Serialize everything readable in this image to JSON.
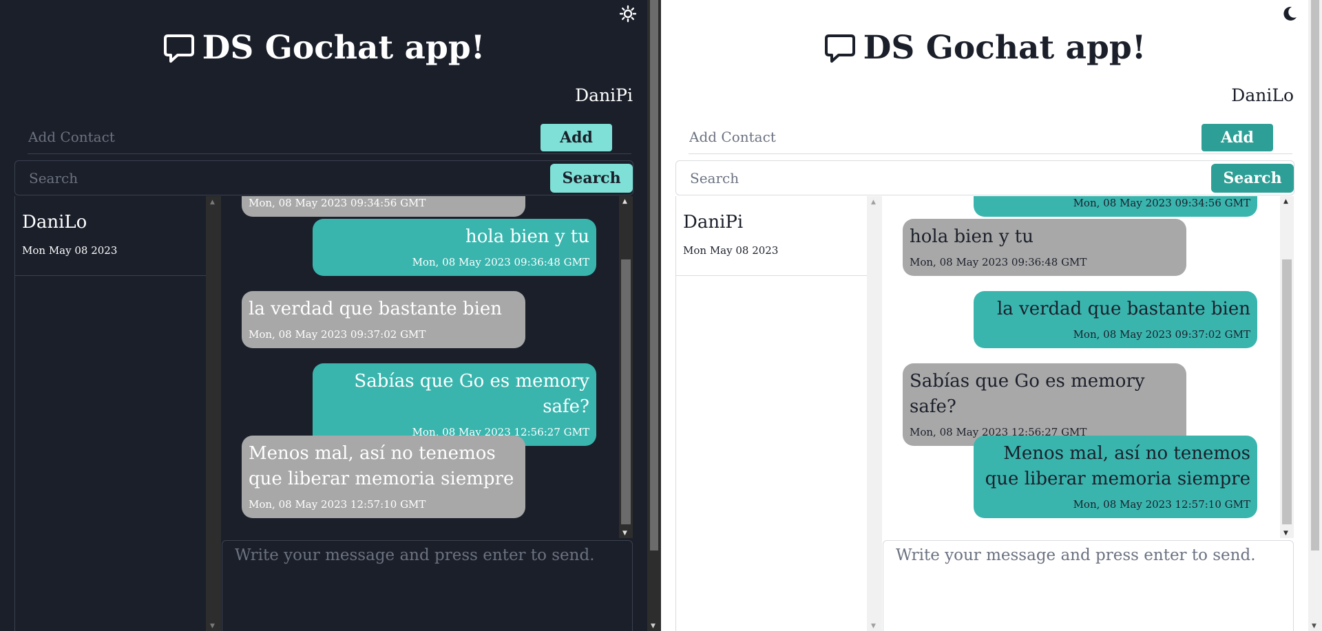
{
  "app": {
    "title": "DS Gochat app!"
  },
  "panes": [
    {
      "theme": "dark",
      "toggle_icon": "sun-icon",
      "username": "DaniPi",
      "add_contact_placeholder": "Add Contact",
      "add_label": "Add",
      "search_placeholder": "Search",
      "search_label": "Search",
      "contacts": [
        {
          "name": "DaniLo",
          "date": "Mon May 08 2023"
        }
      ],
      "messages": [
        {
          "side": "left",
          "text": "",
          "time": "Mon, 08 May 2023 09:34:56 GMT"
        },
        {
          "side": "right",
          "text": "hola bien y tu",
          "time": "Mon, 08 May 2023 09:36:48 GMT"
        },
        {
          "side": "left",
          "text": "la verdad que bastante bien",
          "time": "Mon, 08 May 2023 09:37:02 GMT"
        },
        {
          "side": "right",
          "text": "Sabías que Go es memory safe?",
          "time": "Mon, 08 May 2023 12:56:27 GMT"
        },
        {
          "side": "left",
          "text": "Menos mal, así no tenemos que liberar memoria siempre",
          "time": "Mon, 08 May 2023 12:57:10 GMT"
        }
      ],
      "compose_placeholder": "Write your message and press enter to send."
    },
    {
      "theme": "light",
      "toggle_icon": "moon-icon",
      "username": "DaniLo",
      "add_contact_placeholder": "Add Contact",
      "add_label": "Add",
      "search_placeholder": "Search",
      "search_label": "Search",
      "contacts": [
        {
          "name": "DaniPi",
          "date": "Mon May 08 2023"
        }
      ],
      "messages": [
        {
          "side": "right",
          "text": "",
          "time": "Mon, 08 May 2023 09:34:56 GMT"
        },
        {
          "side": "left",
          "text": "hola bien y tu",
          "time": "Mon, 08 May 2023 09:36:48 GMT"
        },
        {
          "side": "right",
          "text": "la verdad que bastante bien",
          "time": "Mon, 08 May 2023 09:37:02 GMT"
        },
        {
          "side": "left",
          "text": "Sabías que Go es memory safe?",
          "time": "Mon, 08 May 2023 12:56:27 GMT"
        },
        {
          "side": "right",
          "text": "Menos mal, así no tenemos que liberar memoria siempre",
          "time": "Mon, 08 May 2023 12:57:10 GMT"
        }
      ],
      "compose_placeholder": "Write your message and press enter to send."
    }
  ],
  "colors": {
    "dark_bg": "#1b1f2a",
    "light_bg": "#ffffff",
    "accent_dark": "#7ee0d6",
    "accent_light": "#2e9f96",
    "bubble_teal": "#39b5ae",
    "bubble_gray": "#a8a8a8"
  }
}
